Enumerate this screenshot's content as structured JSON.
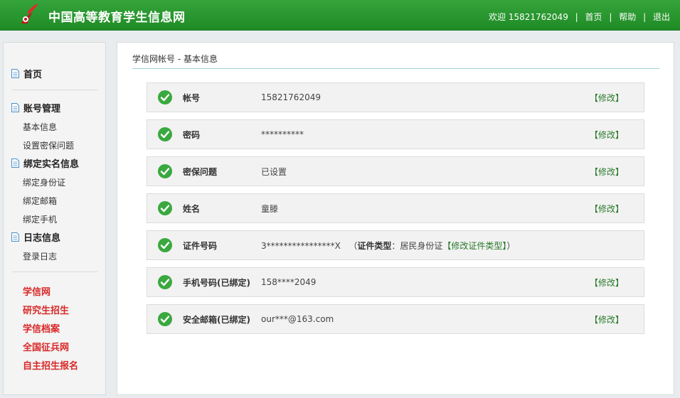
{
  "header": {
    "site_title": "中国高等教育学生信息网",
    "welcome": "欢迎 15821762049",
    "nav": [
      "首页",
      "帮助",
      "退出"
    ]
  },
  "sidebar": {
    "sections": [
      {
        "label": "首页",
        "items": []
      },
      {
        "label": "账号管理",
        "items": [
          "基本信息",
          "设置密保问题"
        ]
      },
      {
        "label": "绑定实名信息",
        "items": [
          "绑定身份证",
          "绑定邮箱",
          "绑定手机"
        ]
      },
      {
        "label": "日志信息",
        "items": [
          "登录日志"
        ]
      }
    ],
    "links": [
      "学信网",
      "研究生招生",
      "学信档案",
      "全国征兵网",
      "自主招生报名"
    ]
  },
  "breadcrumb": "学信网帐号 - 基本信息",
  "rows": [
    {
      "label": "帐号",
      "value": "15821762049",
      "action": "【修改】"
    },
    {
      "label": "密码",
      "value": "**********",
      "action": "【修改】"
    },
    {
      "label": "密保问题",
      "value": "已设置",
      "action": "【修改】"
    },
    {
      "label": "姓名",
      "value": "童滕",
      "action": "【修改】"
    },
    {
      "label": "证件号码",
      "value": "3****************X",
      "type_open": "（",
      "type_label": "证件类型",
      "type_colon": "：",
      "type_value": "居民身份证",
      "type_link": "【修改证件类型】",
      "type_close": "）"
    },
    {
      "label": "手机号码(已绑定)",
      "value": "158****2049",
      "action": "【修改】"
    },
    {
      "label": "安全邮箱(已绑定)",
      "value": "our***@163.com",
      "action": "【修改】"
    }
  ],
  "colors": {
    "header_green": "#2a9a30",
    "link_red": "#d9282a",
    "action_green": "#2a7a2a",
    "check_green": "#3aa83f"
  }
}
